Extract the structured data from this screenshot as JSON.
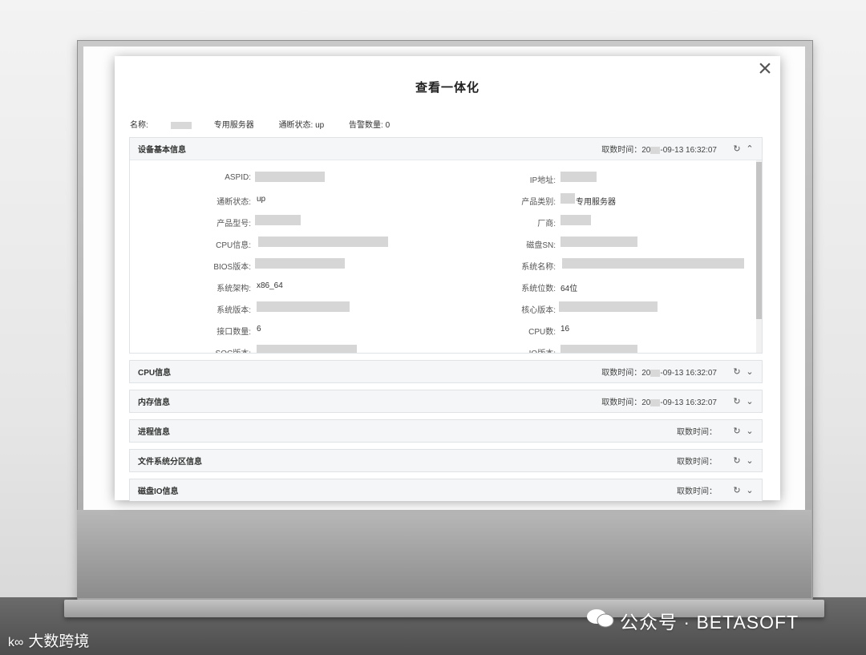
{
  "dialog": {
    "title": "查看一体化",
    "close_icon": "close-icon",
    "summary": {
      "name_label": "名称:",
      "name_value": "专用服务器",
      "status": "通断状态: up",
      "alarm": "告警数量: 0"
    }
  },
  "panels": [
    {
      "title": "设备基本信息",
      "time_label": "取数时间：20",
      "time_value": "-09-13 16:32:07",
      "expanded": true,
      "refresh_icon": "refresh-icon",
      "toggle_icon": "chevron-up-icon"
    },
    {
      "title": "CPU信息",
      "time_label": "取数时间：20",
      "time_value": "-09-13 16:32:07"
    },
    {
      "title": "内存信息",
      "time_label": "取数时间：20",
      "time_value": "-09-13 16:32:07"
    },
    {
      "title": "进程信息",
      "time_label": "取数时间：",
      "time_value": ""
    },
    {
      "title": "文件系统分区信息",
      "time_label": "取数时间：",
      "time_value": ""
    },
    {
      "title": "磁盘IO信息",
      "time_label": "取数时间：",
      "time_value": ""
    }
  ],
  "basic_info": {
    "left": [
      {
        "label": "ASPID:",
        "value": ""
      },
      {
        "label": "通断状态:",
        "value": "up"
      },
      {
        "label": "产品型号:",
        "value": ""
      },
      {
        "label": "CPU信息:",
        "value": ""
      },
      {
        "label": "BIOS版本:",
        "value": ""
      },
      {
        "label": "系统架构:",
        "value": "x86_64"
      },
      {
        "label": "系统版本:",
        "value": ""
      },
      {
        "label": "接口数量:",
        "value": "6"
      },
      {
        "label": "SOC版本:",
        "value": ""
      }
    ],
    "right": [
      {
        "label": "IP地址:",
        "value": ""
      },
      {
        "label": "产品类别:",
        "value": "专用服务器"
      },
      {
        "label": "厂商:",
        "value": ""
      },
      {
        "label": "磁盘SN:",
        "value": ""
      },
      {
        "label": "系统名称:",
        "value": ""
      },
      {
        "label": "系统位数:",
        "value": "64位"
      },
      {
        "label": "核心版本:",
        "value": ""
      },
      {
        "label": "CPU数:",
        "value": "16"
      },
      {
        "label": "IO版本:",
        "value": ""
      }
    ]
  },
  "watermarks": {
    "right": "公众号 · BETASOFT",
    "left": "大数跨境",
    "right_icon": "wechat-icon",
    "left_icon": "logo-icon"
  }
}
